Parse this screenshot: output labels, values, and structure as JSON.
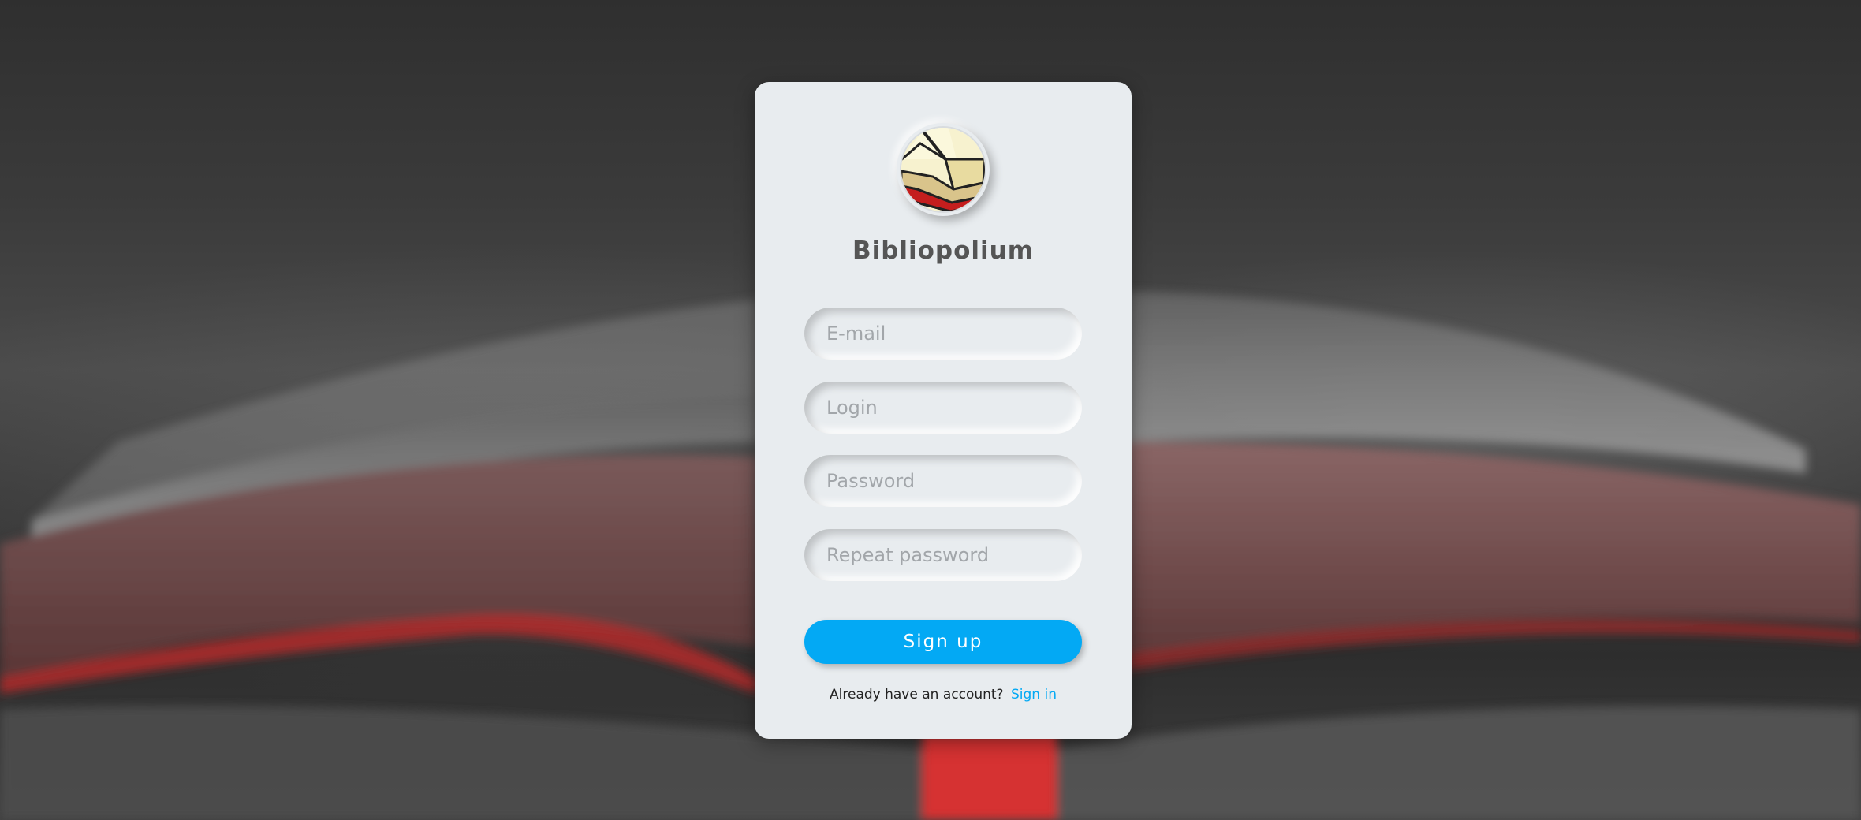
{
  "app": {
    "title": "Bibliopolium",
    "logo_icon": "open-book-icon"
  },
  "form": {
    "email_placeholder": "E-mail",
    "login_placeholder": "Login",
    "password_placeholder": "Password",
    "repeat_password_placeholder": "Repeat password",
    "email_value": "",
    "login_value": "",
    "password_value": "",
    "repeat_password_value": "",
    "submit_label": "Sign up"
  },
  "footer": {
    "prompt": "Already have an account?",
    "link_label": "Sign in"
  },
  "colors": {
    "accent": "#03a9f4",
    "card_background": "#e8ecef",
    "title_text": "#555555"
  }
}
